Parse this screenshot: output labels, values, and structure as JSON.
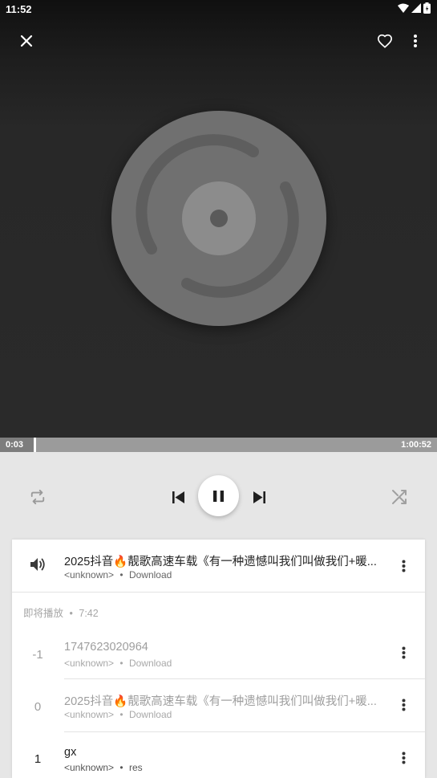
{
  "status_bar": {
    "time": "11:52"
  },
  "player": {
    "current_time": "0:03",
    "duration": "1:00:52",
    "progress": 0.0008
  },
  "now_playing": {
    "title": "2025抖音🔥靓歌高速车载《有一种遗憾叫我们叫做我们+暖...",
    "artist": "<unknown>",
    "separator": "•",
    "album": "Download"
  },
  "queue": {
    "header_label": "即将播放",
    "separator": "•",
    "header_duration": "7:42",
    "items": [
      {
        "index": "-1",
        "title": "1747623020964",
        "artist": "<unknown>",
        "album": "Download"
      },
      {
        "index": "0",
        "title": "2025抖音🔥靓歌高速车载《有一种遗憾叫我们叫做我们+暖...",
        "artist": "<unknown>",
        "album": "Download"
      },
      {
        "index": "1",
        "title": "gx",
        "artist": "<unknown>",
        "album": "res"
      }
    ]
  },
  "colors": {
    "header_bg": "#2a2a2a",
    "seek_bar": "#9b9b9b",
    "panel_bg": "#e6e6e6",
    "card_bg": "#ffffff"
  },
  "icons": [
    "close-icon",
    "heart-outline-icon",
    "more-vert-icon",
    "repeat-icon",
    "skip-previous-icon",
    "pause-icon",
    "skip-next-icon",
    "shuffle-icon",
    "volume-icon"
  ]
}
